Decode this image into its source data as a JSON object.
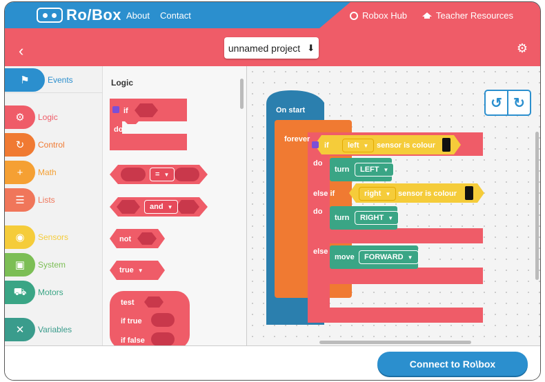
{
  "nav": {
    "brand": "Ro/Box",
    "about": "About",
    "contact": "Contact",
    "hub": "Robox Hub",
    "teacher": "Teacher Resources"
  },
  "header": {
    "project_name": "unnamed project"
  },
  "categories": [
    {
      "label": "Events",
      "color": "#2b8fce",
      "icon": "flag-icon"
    },
    {
      "label": "Logic",
      "color": "#ef5c68",
      "icon": "gear-icon"
    },
    {
      "label": "Control",
      "color": "#f07a32",
      "icon": "loop-icon"
    },
    {
      "label": "Math",
      "color": "#f5a033",
      "icon": "plus-icon"
    },
    {
      "label": "Lists",
      "color": "#f0765a",
      "icon": "list-icon"
    },
    {
      "label": "Sensors",
      "color": "#f5cc3a",
      "icon": "eye-icon"
    },
    {
      "label": "System",
      "color": "#7cbe55",
      "icon": "robot-icon"
    },
    {
      "label": "Motors",
      "color": "#3aa585",
      "icon": "car-icon"
    },
    {
      "label": "Variables",
      "color": "#3a9c8c",
      "icon": "x-icon"
    }
  ],
  "flyout": {
    "title": "Logic",
    "if_label": "if",
    "do_label": "do",
    "compare_op": "=",
    "and_op": "and",
    "not_label": "not",
    "true_label": "true",
    "test_label": "test",
    "if_true_label": "if true",
    "if_false_label": "if false"
  },
  "workspace": {
    "on_start": "On start",
    "forever": "forever",
    "if": "if",
    "do": "do",
    "else_if": "else if",
    "do2": "do",
    "else": "else",
    "left": "left",
    "sensor_is_colour": "sensor is colour",
    "right": "right",
    "sensor_is_colour2": "sensor is colour",
    "turn": "turn",
    "turn_left": "LEFT",
    "turn2": "turn",
    "turn_right": "RIGHT",
    "move": "move",
    "forward": "FORWARD"
  },
  "footer": {
    "connect": "Connect to Ro\\box"
  }
}
